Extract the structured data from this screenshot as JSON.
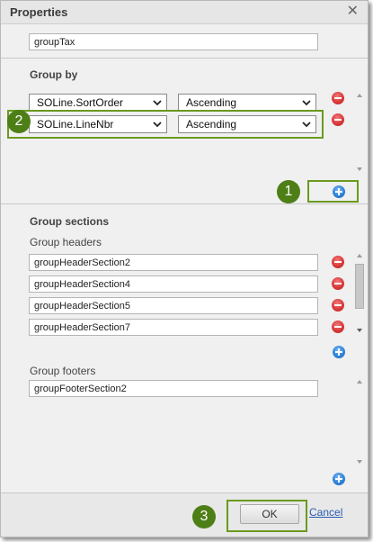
{
  "dialog": {
    "title": "Properties",
    "close_icon": "close-icon"
  },
  "group_name": {
    "value": "groupTax"
  },
  "group_by": {
    "heading": "Group by",
    "rows": [
      {
        "field": "SOLine.SortOrder",
        "order": "Ascending"
      },
      {
        "field": "SOLine.LineNbr",
        "order": "Ascending"
      }
    ]
  },
  "group_sections": {
    "heading": "Group sections",
    "headers_label": "Group headers",
    "headers": [
      "groupHeaderSection2",
      "groupHeaderSection4",
      "groupHeaderSection5",
      "groupHeaderSection7"
    ],
    "footers_label": "Group footers",
    "footers": [
      "groupFooterSection2"
    ]
  },
  "callouts": [
    "1",
    "2",
    "3"
  ],
  "footer": {
    "ok_label": "OK",
    "cancel_label": "Cancel"
  },
  "colors": {
    "callout_green": "#4d7f16",
    "remove_red": "#d93a3a",
    "add_blue": "#2f83d8",
    "link_blue": "#2a5db0"
  }
}
